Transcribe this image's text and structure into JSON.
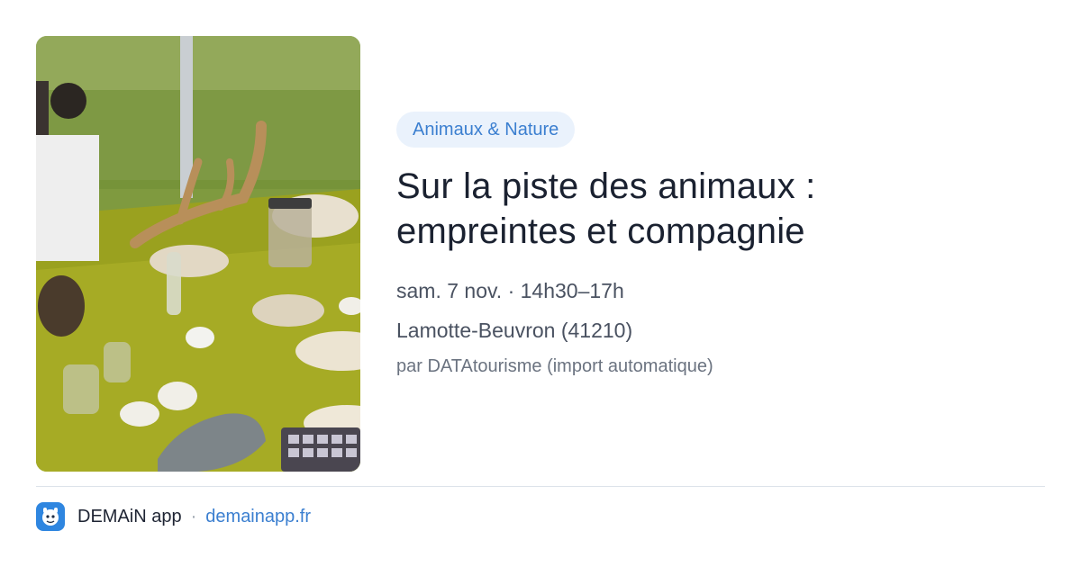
{
  "card": {
    "image_alt": "Sur la piste des animaux",
    "category": "Animaux & Nature",
    "title_line1": "Sur la piste des animaux :",
    "title_line2": "empreintes et compagnie",
    "datetime": "sam. 7 nov. · 14h30–17h",
    "location": "Lamotte-Beuvron (41210)",
    "source": "par DATAtourisme (import automatique)"
  },
  "footer": {
    "app_name": "DEMAiN app",
    "separator": "·",
    "domain": "demainapp.fr",
    "icon": "demain-app-icon"
  },
  "colors": {
    "accent": "#3b7fd0",
    "tag_background": "#eaf2fc",
    "app_icon": "#2f86e0"
  }
}
